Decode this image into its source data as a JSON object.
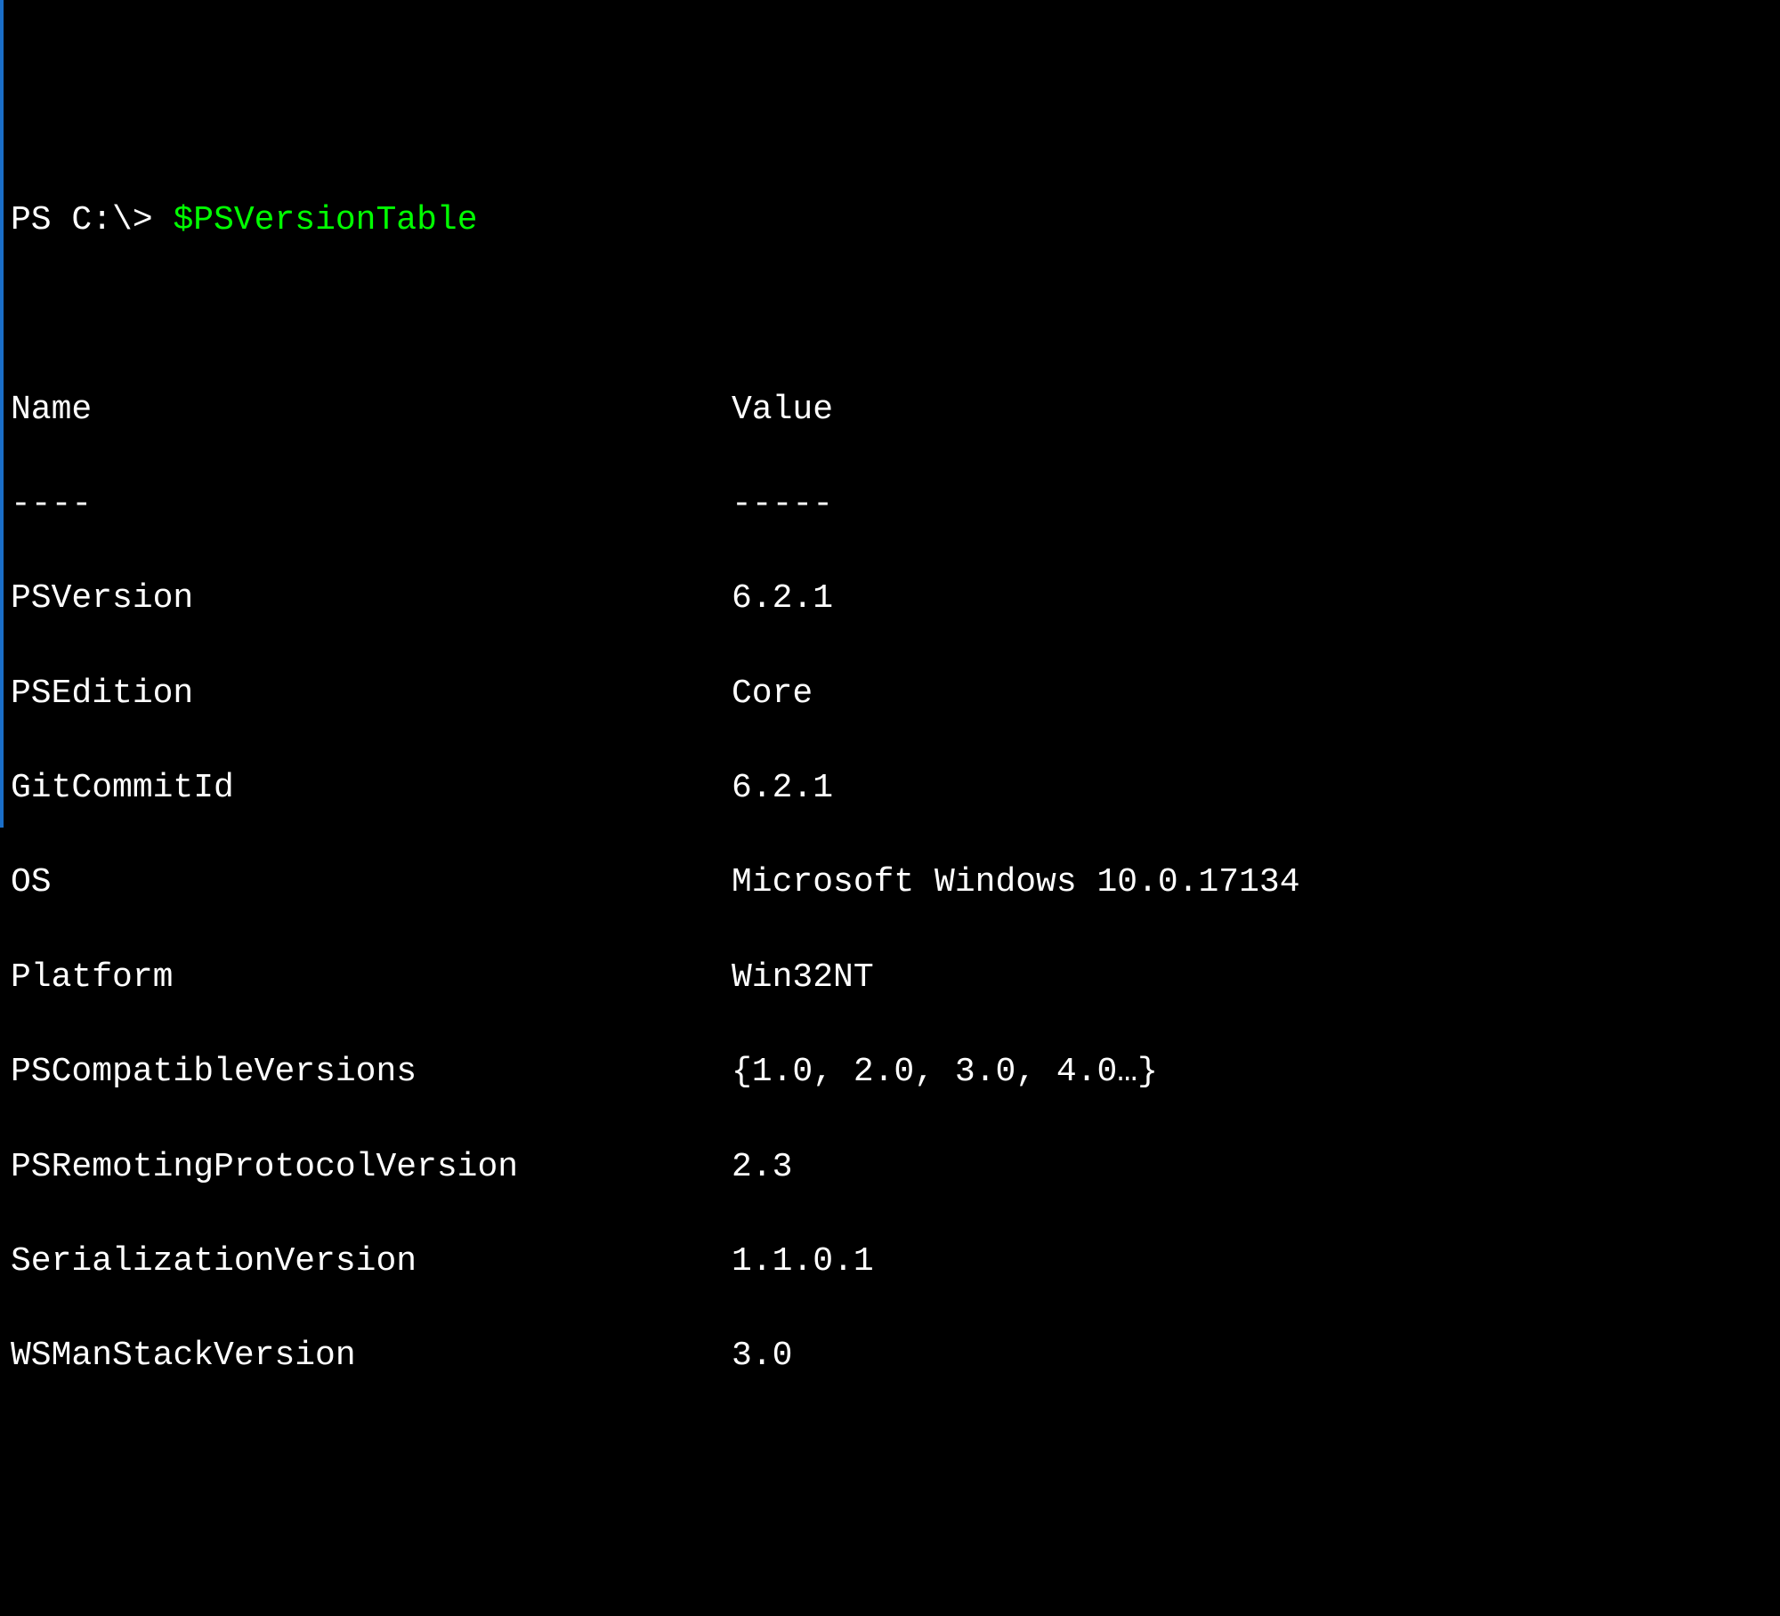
{
  "prompt": "PS C:\\> ",
  "command": "$PSVersionTable",
  "columns": {
    "name": "Name",
    "value": "Value"
  },
  "separators": {
    "name": "----",
    "value": "-----"
  },
  "rows": [
    {
      "name": "PSVersion",
      "value": "6.2.1"
    },
    {
      "name": "PSEdition",
      "value": "Core"
    },
    {
      "name": "GitCommitId",
      "value": "6.2.1"
    },
    {
      "name": "OS",
      "value": "Microsoft Windows 10.0.17134"
    },
    {
      "name": "Platform",
      "value": "Win32NT"
    },
    {
      "name": "PSCompatibleVersions",
      "value": "{1.0, 2.0, 3.0, 4.0…}"
    },
    {
      "name": "PSRemotingProtocolVersion",
      "value": "2.3"
    },
    {
      "name": "SerializationVersion",
      "value": "1.1.0.1"
    },
    {
      "name": "WSManStackVersion",
      "value": "3.0"
    }
  ]
}
